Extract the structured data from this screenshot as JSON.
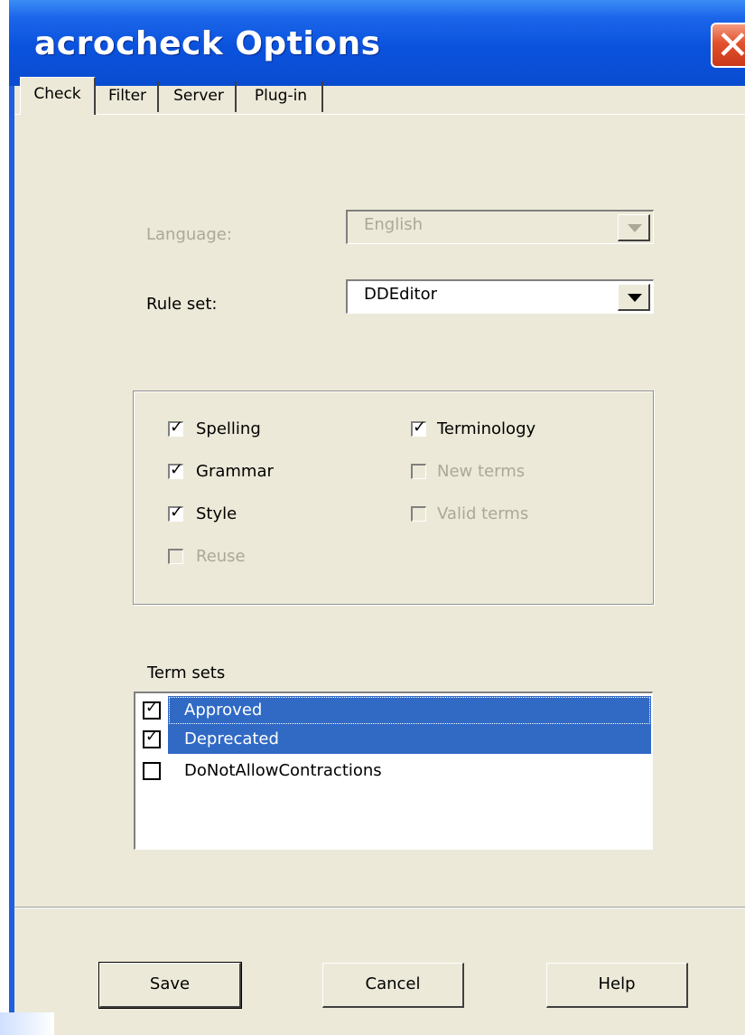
{
  "window": {
    "title": "acrocheck Options",
    "close_icon": "close-icon"
  },
  "tabs": [
    {
      "label": "Check",
      "active": true
    },
    {
      "label": "Filter",
      "active": false
    },
    {
      "label": "Server",
      "active": false
    },
    {
      "label": "Plug-in",
      "active": false
    }
  ],
  "language": {
    "label": "Language:",
    "value": "English",
    "enabled": false
  },
  "rule_set": {
    "label": "Rule set:",
    "value": "DDEditor",
    "enabled": true
  },
  "options": {
    "spelling": {
      "label": "Spelling",
      "checked": true,
      "enabled": true
    },
    "grammar": {
      "label": "Grammar",
      "checked": true,
      "enabled": true
    },
    "style": {
      "label": "Style",
      "checked": true,
      "enabled": true
    },
    "reuse": {
      "label": "Reuse",
      "checked": false,
      "enabled": false
    },
    "terminology": {
      "label": "Terminology",
      "checked": true,
      "enabled": true
    },
    "new_terms": {
      "label": "New terms",
      "checked": false,
      "enabled": false
    },
    "valid_terms": {
      "label": "Valid terms",
      "checked": false,
      "enabled": false
    }
  },
  "term_sets": {
    "label": "Term sets",
    "items": [
      {
        "label": "Approved",
        "checked": true,
        "selected": true
      },
      {
        "label": "Deprecated",
        "checked": true,
        "selected": true
      },
      {
        "label": "DoNotAllowContractions",
        "checked": false,
        "selected": false
      }
    ]
  },
  "buttons": {
    "save": "Save",
    "cancel": "Cancel",
    "help": "Help"
  },
  "colors": {
    "titlebar": "#0a52dd",
    "selection": "#316ac5",
    "dialog_bg": "#ece9d8",
    "close": "#e2512d"
  }
}
